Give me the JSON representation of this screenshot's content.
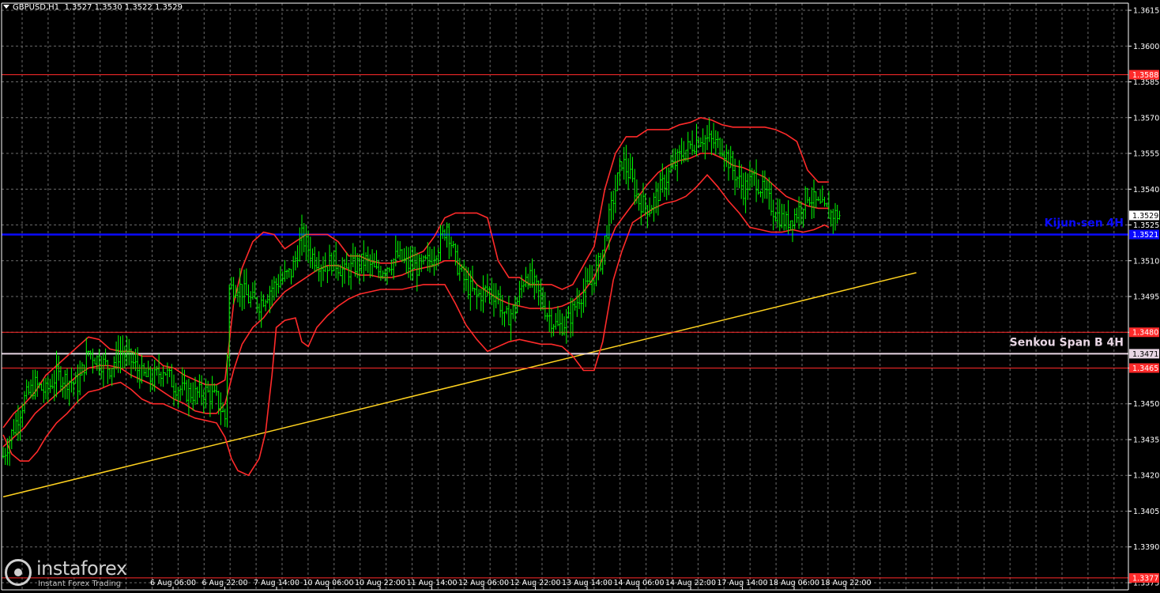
{
  "header": {
    "symbol": "GBPUSD,H1",
    "ohlc": "1.3527 1.3530 1.3522 1.3529"
  },
  "watermark": {
    "brand": "instaforex",
    "tagline": "Instant Forex Trading"
  },
  "chart_data": {
    "type": "candlestick",
    "ylim": [
      1.337,
      1.362
    ],
    "y_ticks": [
      "1.3615",
      "1.3600",
      "1.3585",
      "1.3570",
      "1.3555",
      "1.3540",
      "1.3525",
      "1.3510",
      "1.3495",
      "1.3480",
      "1.3465",
      "1.3450",
      "1.3435",
      "1.3420",
      "1.3405",
      "1.3390",
      "1.3375"
    ],
    "x_ticks": [
      "6 Aug 06:00",
      "6 Aug 22:00",
      "7 Aug 14:00",
      "10 Aug 06:00",
      "10 Aug 22:00",
      "11 Aug 14:00",
      "12 Aug 06:00",
      "12 Aug 22:00",
      "13 Aug 14:00",
      "14 Aug 06:00",
      "14 Aug 22:00",
      "17 Aug 14:00",
      "18 Aug 06:00",
      "18 Aug 22:00"
    ],
    "horizontal_levels": [
      {
        "label": "1.3588",
        "value": 1.3588,
        "color": "#ff2a2a"
      },
      {
        "label": "1.3480",
        "value": 1.348,
        "color": "#ff2a2a"
      },
      {
        "label": "1.3465",
        "value": 1.3465,
        "color": "#ff2a2a"
      },
      {
        "label": "1.3377",
        "value": 1.3377,
        "color": "#ff2a2a"
      },
      {
        "label": "1.3471",
        "value": 1.3471,
        "color": "#e8d6e4",
        "name": "Senkou Span B 4H"
      },
      {
        "label": "1.3521",
        "value": 1.3521,
        "color": "#0a0aff",
        "name": "Kijun-sen 4H"
      }
    ],
    "current_price": {
      "label": "1.3529",
      "value": 1.3529
    },
    "trendline": {
      "color": "#ffd21f",
      "from": [
        0,
        1.3411
      ],
      "to": [
        428,
        1.3505
      ]
    },
    "candle_color": "#00ff00",
    "band_color": "#ff2a2a",
    "close_path": [
      [
        0,
        1.3428
      ],
      [
        5,
        1.344
      ],
      [
        10,
        1.3452
      ],
      [
        15,
        1.3458
      ],
      [
        20,
        1.3455
      ],
      [
        25,
        1.3462
      ],
      [
        30,
        1.346
      ],
      [
        35,
        1.3458
      ],
      [
        40,
        1.3472
      ],
      [
        45,
        1.3468
      ],
      [
        50,
        1.3465
      ],
      [
        55,
        1.3472
      ],
      [
        60,
        1.3468
      ],
      [
        65,
        1.3462
      ],
      [
        70,
        1.346
      ],
      [
        75,
        1.3465
      ],
      [
        80,
        1.3458
      ],
      [
        85,
        1.3455
      ],
      [
        90,
        1.3454
      ],
      [
        95,
        1.3455
      ],
      [
        100,
        1.3452
      ],
      [
        104,
        1.3444
      ],
      [
        106,
        1.3498
      ],
      [
        110,
        1.35
      ],
      [
        115,
        1.3494
      ],
      [
        120,
        1.3492
      ],
      [
        125,
        1.3498
      ],
      [
        130,
        1.3502
      ],
      [
        135,
        1.3505
      ],
      [
        140,
        1.352
      ],
      [
        145,
        1.3512
      ],
      [
        150,
        1.3508
      ],
      [
        155,
        1.351
      ],
      [
        160,
        1.3505
      ],
      [
        165,
        1.3508
      ],
      [
        170,
        1.351
      ],
      [
        175,
        1.3505
      ],
      [
        180,
        1.3508
      ],
      [
        185,
        1.3512
      ],
      [
        190,
        1.3508
      ],
      [
        195,
        1.3507
      ],
      [
        200,
        1.351
      ],
      [
        205,
        1.3518
      ],
      [
        208,
        1.3525
      ],
      [
        212,
        1.351
      ],
      [
        217,
        1.35
      ],
      [
        222,
        1.3495
      ],
      [
        227,
        1.3498
      ],
      [
        232,
        1.3495
      ],
      [
        235,
        1.3485
      ],
      [
        240,
        1.349
      ],
      [
        245,
        1.3505
      ],
      [
        250,
        1.3498
      ],
      [
        255,
        1.3488
      ],
      [
        260,
        1.3482
      ],
      [
        265,
        1.3485
      ],
      [
        270,
        1.3495
      ],
      [
        275,
        1.35
      ],
      [
        280,
        1.351
      ],
      [
        285,
        1.3532
      ],
      [
        290,
        1.3552
      ],
      [
        294,
        1.3545
      ],
      [
        298,
        1.3535
      ],
      [
        303,
        1.3532
      ],
      [
        308,
        1.354
      ],
      [
        313,
        1.3548
      ],
      [
        318,
        1.3555
      ],
      [
        322,
        1.3558
      ],
      [
        327,
        1.3562
      ],
      [
        332,
        1.356
      ],
      [
        337,
        1.3558
      ],
      [
        342,
        1.3548
      ],
      [
        347,
        1.354
      ],
      [
        352,
        1.3545
      ],
      [
        357,
        1.3538
      ],
      [
        362,
        1.353
      ],
      [
        367,
        1.3526
      ],
      [
        372,
        1.353
      ],
      [
        377,
        1.3538
      ],
      [
        382,
        1.3533
      ],
      [
        387,
        1.353
      ],
      [
        392,
        1.3529
      ]
    ],
    "upper_band": [
      [
        0,
        1.344
      ],
      [
        5,
        1.3446
      ],
      [
        10,
        1.345
      ],
      [
        15,
        1.3455
      ],
      [
        20,
        1.3462
      ],
      [
        25,
        1.3466
      ],
      [
        30,
        1.347
      ],
      [
        35,
        1.3474
      ],
      [
        40,
        1.3478
      ],
      [
        45,
        1.3477
      ],
      [
        50,
        1.3473
      ],
      [
        55,
        1.3472
      ],
      [
        60,
        1.3472
      ],
      [
        65,
        1.347
      ],
      [
        70,
        1.347
      ],
      [
        75,
        1.3466
      ],
      [
        80,
        1.3465
      ],
      [
        85,
        1.3462
      ],
      [
        90,
        1.346
      ],
      [
        95,
        1.3458
      ],
      [
        100,
        1.3458
      ],
      [
        104,
        1.346
      ],
      [
        108,
        1.3492
      ],
      [
        112,
        1.3507
      ],
      [
        117,
        1.3518
      ],
      [
        122,
        1.3522
      ],
      [
        127,
        1.3521
      ],
      [
        132,
        1.3515
      ],
      [
        137,
        1.3518
      ],
      [
        142,
        1.3521
      ],
      [
        147,
        1.3521
      ],
      [
        152,
        1.3521
      ],
      [
        157,
        1.3518
      ],
      [
        162,
        1.3512
      ],
      [
        167,
        1.3512
      ],
      [
        172,
        1.351
      ],
      [
        177,
        1.3509
      ],
      [
        182,
        1.3509
      ],
      [
        187,
        1.351
      ],
      [
        192,
        1.3512
      ],
      [
        197,
        1.3514
      ],
      [
        202,
        1.352
      ],
      [
        207,
        1.3528
      ],
      [
        212,
        1.353
      ],
      [
        217,
        1.353
      ],
      [
        222,
        1.353
      ],
      [
        227,
        1.3528
      ],
      [
        232,
        1.351
      ],
      [
        237,
        1.3503
      ],
      [
        242,
        1.3503
      ],
      [
        247,
        1.35
      ],
      [
        252,
        1.35
      ],
      [
        257,
        1.35
      ],
      [
        262,
        1.3498
      ],
      [
        267,
        1.35
      ],
      [
        272,
        1.3508
      ],
      [
        277,
        1.3516
      ],
      [
        282,
        1.354
      ],
      [
        287,
        1.3555
      ],
      [
        292,
        1.3562
      ],
      [
        297,
        1.3562
      ],
      [
        302,
        1.3565
      ],
      [
        307,
        1.3565
      ],
      [
        312,
        1.3565
      ],
      [
        317,
        1.3567
      ],
      [
        322,
        1.3568
      ],
      [
        327,
        1.357
      ],
      [
        332,
        1.3569
      ],
      [
        337,
        1.3567
      ],
      [
        342,
        1.3566
      ],
      [
        347,
        1.3566
      ],
      [
        352,
        1.3566
      ],
      [
        357,
        1.3566
      ],
      [
        362,
        1.3565
      ],
      [
        367,
        1.3563
      ],
      [
        372,
        1.356
      ],
      [
        377,
        1.3548
      ],
      [
        382,
        1.3543
      ],
      [
        387,
        1.3543
      ]
    ],
    "middle_band": [
      [
        0,
        1.3432
      ],
      [
        5,
        1.3436
      ],
      [
        10,
        1.344
      ],
      [
        15,
        1.3446
      ],
      [
        20,
        1.345
      ],
      [
        25,
        1.3454
      ],
      [
        30,
        1.3458
      ],
      [
        35,
        1.3462
      ],
      [
        40,
        1.3465
      ],
      [
        45,
        1.3466
      ],
      [
        50,
        1.3466
      ],
      [
        55,
        1.3465
      ],
      [
        60,
        1.3462
      ],
      [
        65,
        1.346
      ],
      [
        70,
        1.3458
      ],
      [
        75,
        1.3455
      ],
      [
        80,
        1.3452
      ],
      [
        85,
        1.345
      ],
      [
        90,
        1.3447
      ],
      [
        95,
        1.3446
      ],
      [
        100,
        1.3446
      ],
      [
        104,
        1.345
      ],
      [
        108,
        1.3464
      ],
      [
        112,
        1.3475
      ],
      [
        117,
        1.3482
      ],
      [
        122,
        1.3486
      ],
      [
        127,
        1.3492
      ],
      [
        132,
        1.3497
      ],
      [
        137,
        1.35
      ],
      [
        142,
        1.3503
      ],
      [
        147,
        1.3506
      ],
      [
        152,
        1.3508
      ],
      [
        157,
        1.3508
      ],
      [
        162,
        1.3506
      ],
      [
        167,
        1.3504
      ],
      [
        172,
        1.3504
      ],
      [
        177,
        1.3503
      ],
      [
        182,
        1.3503
      ],
      [
        187,
        1.3504
      ],
      [
        192,
        1.3506
      ],
      [
        197,
        1.3507
      ],
      [
        202,
        1.3508
      ],
      [
        207,
        1.351
      ],
      [
        212,
        1.351
      ],
      [
        217,
        1.3506
      ],
      [
        222,
        1.35
      ],
      [
        227,
        1.3497
      ],
      [
        232,
        1.3494
      ],
      [
        237,
        1.3492
      ],
      [
        242,
        1.3491
      ],
      [
        247,
        1.349
      ],
      [
        252,
        1.349
      ],
      [
        257,
        1.349
      ],
      [
        262,
        1.3491
      ],
      [
        267,
        1.3493
      ],
      [
        272,
        1.3497
      ],
      [
        277,
        1.3503
      ],
      [
        282,
        1.3513
      ],
      [
        287,
        1.3524
      ],
      [
        292,
        1.353
      ],
      [
        297,
        1.3536
      ],
      [
        302,
        1.3542
      ],
      [
        307,
        1.3547
      ],
      [
        312,
        1.355
      ],
      [
        317,
        1.3552
      ],
      [
        322,
        1.3553
      ],
      [
        327,
        1.3555
      ],
      [
        332,
        1.3555
      ],
      [
        337,
        1.3553
      ],
      [
        342,
        1.355
      ],
      [
        347,
        1.3549
      ],
      [
        352,
        1.3547
      ],
      [
        357,
        1.3545
      ],
      [
        362,
        1.3541
      ],
      [
        367,
        1.3537
      ],
      [
        372,
        1.3535
      ],
      [
        377,
        1.3533
      ],
      [
        382,
        1.3532
      ],
      [
        387,
        1.3532
      ]
    ],
    "lower_band": [
      [
        0,
        1.3437
      ],
      [
        4,
        1.3429
      ],
      [
        8,
        1.3426
      ],
      [
        12,
        1.3426
      ],
      [
        16,
        1.343
      ],
      [
        20,
        1.3436
      ],
      [
        25,
        1.3442
      ],
      [
        30,
        1.3446
      ],
      [
        35,
        1.3451
      ],
      [
        40,
        1.3455
      ],
      [
        45,
        1.3456
      ],
      [
        50,
        1.3458
      ],
      [
        55,
        1.3459
      ],
      [
        60,
        1.3456
      ],
      [
        65,
        1.3452
      ],
      [
        70,
        1.345
      ],
      [
        75,
        1.345
      ],
      [
        80,
        1.3448
      ],
      [
        85,
        1.3446
      ],
      [
        90,
        1.3444
      ],
      [
        95,
        1.3443
      ],
      [
        100,
        1.3442
      ],
      [
        104,
        1.3436
      ],
      [
        107,
        1.3427
      ],
      [
        110,
        1.3422
      ],
      [
        115,
        1.342
      ],
      [
        120,
        1.3427
      ],
      [
        123,
        1.3438
      ],
      [
        126,
        1.3462
      ],
      [
        128,
        1.3482
      ],
      [
        132,
        1.3485
      ],
      [
        137,
        1.3486
      ],
      [
        140,
        1.3476
      ],
      [
        143,
        1.3474
      ],
      [
        147,
        1.3482
      ],
      [
        152,
        1.3487
      ],
      [
        157,
        1.3491
      ],
      [
        162,
        1.3494
      ],
      [
        167,
        1.3496
      ],
      [
        172,
        1.3497
      ],
      [
        177,
        1.3498
      ],
      [
        182,
        1.3498
      ],
      [
        187,
        1.3498
      ],
      [
        192,
        1.3499
      ],
      [
        197,
        1.35
      ],
      [
        202,
        1.35
      ],
      [
        207,
        1.35
      ],
      [
        212,
        1.3492
      ],
      [
        217,
        1.3483
      ],
      [
        222,
        1.3477
      ],
      [
        227,
        1.3472
      ],
      [
        232,
        1.3474
      ],
      [
        237,
        1.3476
      ],
      [
        242,
        1.3477
      ],
      [
        247,
        1.3476
      ],
      [
        252,
        1.3475
      ],
      [
        257,
        1.3475
      ],
      [
        262,
        1.3474
      ],
      [
        267,
        1.347
      ],
      [
        272,
        1.3464
      ],
      [
        277,
        1.3464
      ],
      [
        281,
        1.3476
      ],
      [
        286,
        1.3502
      ],
      [
        290,
        1.3514
      ],
      [
        295,
        1.3526
      ],
      [
        300,
        1.3529
      ],
      [
        305,
        1.3532
      ],
      [
        310,
        1.3534
      ],
      [
        315,
        1.3535
      ],
      [
        320,
        1.3537
      ],
      [
        325,
        1.3541
      ],
      [
        330,
        1.3546
      ],
      [
        335,
        1.3541
      ],
      [
        340,
        1.3535
      ],
      [
        345,
        1.353
      ],
      [
        350,
        1.3524
      ],
      [
        355,
        1.3523
      ],
      [
        360,
        1.3522
      ],
      [
        365,
        1.3522
      ],
      [
        370,
        1.3523
      ],
      [
        375,
        1.3522
      ],
      [
        380,
        1.3523
      ],
      [
        385,
        1.3525
      ],
      [
        387,
        1.3524
      ]
    ]
  }
}
